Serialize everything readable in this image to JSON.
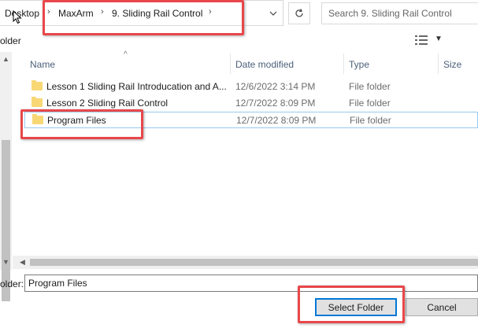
{
  "address": {
    "crumbs": [
      "Desktop",
      "MaxArm",
      "9. Sliding Rail Control"
    ],
    "separator": "›"
  },
  "search": {
    "placeholder": "Search 9. Sliding Rail Control"
  },
  "toolbar": {
    "left_label": "older"
  },
  "columns": {
    "name": "Name",
    "date": "Date modified",
    "type": "Type",
    "size": "Size"
  },
  "files": [
    {
      "name": "Lesson 1 Sliding Rail Introducation and A...",
      "date": "12/6/2022 3:14 PM",
      "type": "File folder"
    },
    {
      "name": "Lesson 2 Sliding Rail Control",
      "date": "12/7/2022 8:09 PM",
      "type": "File folder"
    },
    {
      "name": "Program Files",
      "date": "12/7/2022 8:09 PM",
      "type": "File folder"
    }
  ],
  "footer": {
    "folder_label": "older:",
    "folder_value": "Program Files",
    "select_label": "Select Folder",
    "cancel_label": "Cancel"
  },
  "colors": {
    "annotation": "#e8474a",
    "folder": "#f8d775",
    "selection": "#99c9ef",
    "accent": "#0078d7"
  }
}
